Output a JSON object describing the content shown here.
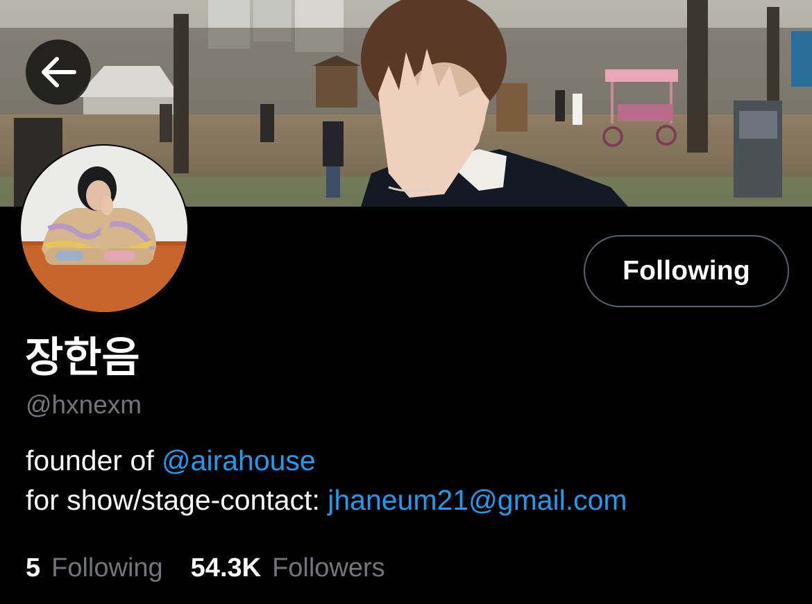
{
  "header": {
    "back_icon": "arrow-left-icon"
  },
  "profile": {
    "display_name": "장한음",
    "handle": "@hxnexm",
    "follow_button_label": "Following",
    "bio": {
      "line1_text": "founder of ",
      "line1_link": "@airahouse",
      "line2_text": "for show/stage-contact: ",
      "line2_link": "jhaneum21@gmail.com"
    },
    "stats": {
      "following_count": "5",
      "following_label": "Following",
      "followers_count": "54.3K",
      "followers_label": "Followers"
    }
  },
  "colors": {
    "background": "#000000",
    "text_primary": "#ffffff",
    "text_secondary": "#71767b",
    "link": "#1d9bf0",
    "button_border": "#536471"
  }
}
